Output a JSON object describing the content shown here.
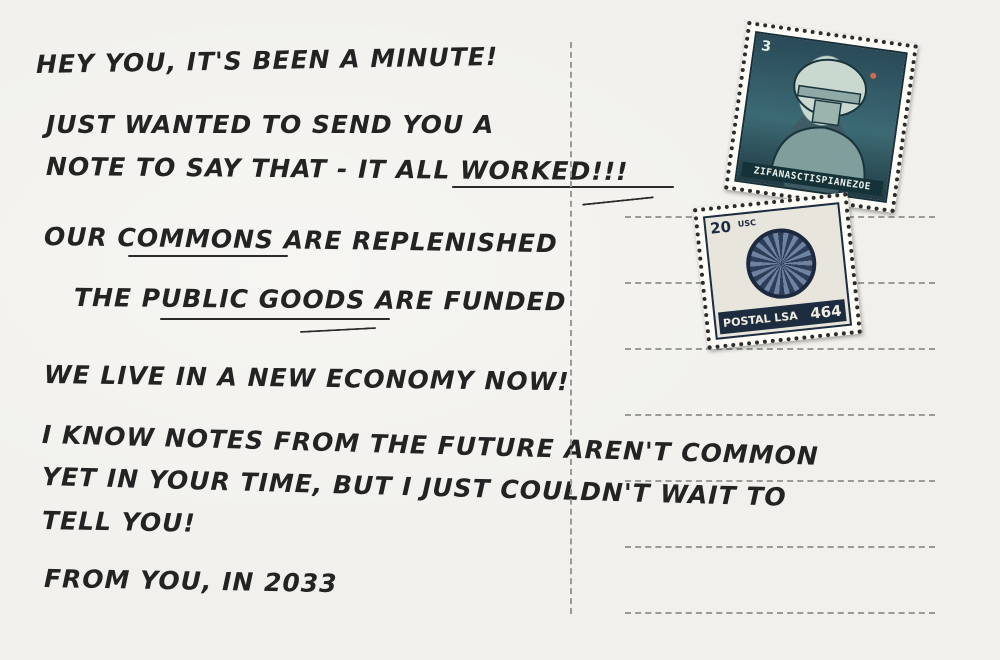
{
  "note": {
    "greeting": "HEY YOU, IT'S BEEN A MINUTE!",
    "line1": "JUST WANTED TO SEND YOU A",
    "line2": "NOTE  TO SAY THAT - IT ALL WORKED!!!",
    "line3": "OUR COMMONS ARE REPLENISHED",
    "line4": "THE PUBLIC GOODS ARE FUNDED",
    "line5": "WE LIVE IN A NEW ECONOMY NOW!",
    "line6": "I KNOW NOTES FROM THE FUTURE AREN'T COMMON",
    "line7": "YET IN YOUR TIME, BUT I JUST COULDN'T WAIT TO",
    "line8": "TELL YOU!",
    "signoff": "FROM YOU, IN 2033"
  },
  "stamps": {
    "robot": {
      "number": "3",
      "caption": "ZIFANASCTISPIANEZOE",
      "icon": "robot-stamp-art"
    },
    "globe": {
      "denomination": "20",
      "mark": "USC",
      "caption": "POSTAL LSA",
      "value": "464",
      "icon": "globe-stamp-art"
    }
  },
  "colors": {
    "paper": "#f1f0ec",
    "ink": "#232323",
    "dashed_line": "#9a9a96"
  }
}
